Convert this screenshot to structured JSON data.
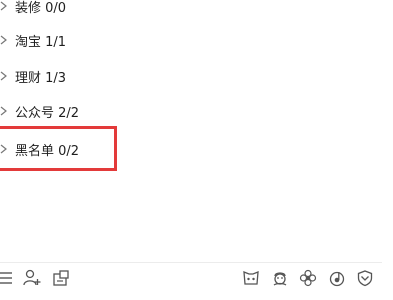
{
  "groups": [
    {
      "label": "装修 0/0"
    },
    {
      "label": "淘宝 1/1"
    },
    {
      "label": "理财 1/3"
    },
    {
      "label": "公众号 2/2"
    },
    {
      "label": "黑名单 0/2"
    }
  ],
  "icons": {
    "menu": "menu-icon",
    "add_contact": "add-contact-icon",
    "app_manager": "app-manager-icon",
    "game": "game-icon",
    "pet": "pet-icon",
    "flower": "flower-icon",
    "music": "music-icon",
    "shield": "shield-icon"
  },
  "colors": {
    "highlight_border": "#e33a3a",
    "text": "#1e1e1e",
    "icon": "#555555"
  }
}
